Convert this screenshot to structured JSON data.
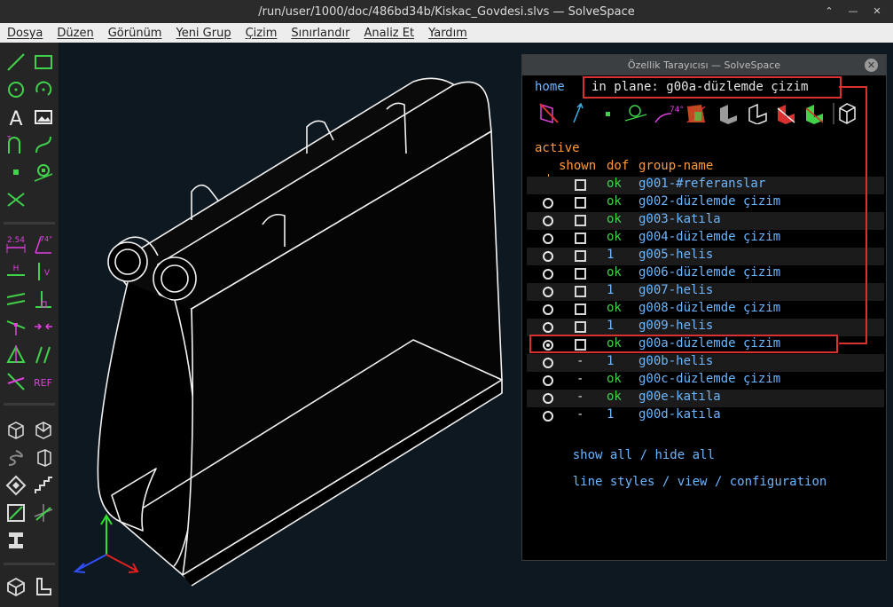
{
  "window": {
    "title": "/run/user/1000/doc/486bd34b/Kiskac_Govdesi.slvs — SolveSpace",
    "buttons": [
      "⌃",
      "—",
      "✕"
    ]
  },
  "menu": [
    "Dosya",
    "Düzen",
    "Görünüm",
    "Yeni Grup",
    "Çizim",
    "Sınırlandır",
    "Analiz Et",
    "Yardım"
  ],
  "toolbar": {
    "labels": {
      "dim": "2.54",
      "angle": "74°",
      "horiz": "H",
      "vert": "V",
      "ref": "REF",
      "text": "A"
    },
    "icons": [
      "line-icon",
      "rectangle-icon",
      "circle-icon",
      "arc-icon",
      "text-icon",
      "image-icon",
      "tangent-arc-icon",
      "bezier-icon",
      "point-icon",
      "construction-icon",
      "split-icon",
      "distance-constraint-icon",
      "angle-constraint-icon",
      "horizontal-icon",
      "vertical-icon",
      "parallel-icon",
      "perpendicular-icon",
      "point-on-line-icon",
      "midpoint-icon",
      "symmetric-icon",
      "equal-icon",
      "other-constraint-icon",
      "reference-icon",
      "workplane-icon",
      "extrude-icon",
      "lathe-icon",
      "revolve-icon",
      "helix-icon",
      "step-icon",
      "sketch-in-3d-icon",
      "sketch-in-plane-icon",
      "link-icon",
      "import-icon",
      "solid-icon",
      "step-translate-icon"
    ]
  },
  "browser": {
    "panel_title": "Özellik Tarayıcısı — SolveSpace",
    "close_label": "✕",
    "home_link": "home",
    "plane_text": "in plane: g00a-düzlemde çizim",
    "active_label": "active",
    "columns": {
      "shown": "shown",
      "dof": "dof",
      "group_name": "group-name"
    },
    "groups": [
      {
        "shown": "box",
        "dof": "ok",
        "name": "g001-#referanslar",
        "radio": "none"
      },
      {
        "shown": "box",
        "dof": "ok",
        "name": "g002-düzlemde çizim",
        "radio": "empty"
      },
      {
        "shown": "box",
        "dof": "ok",
        "name": "g003-katıla",
        "radio": "empty"
      },
      {
        "shown": "box",
        "dof": "ok",
        "name": "g004-düzlemde çizim",
        "radio": "empty"
      },
      {
        "shown": "box",
        "dof": "1",
        "name": "g005-helis",
        "radio": "empty"
      },
      {
        "shown": "box",
        "dof": "ok",
        "name": "g006-düzlemde çizim",
        "radio": "empty"
      },
      {
        "shown": "box",
        "dof": "1",
        "name": "g007-helis",
        "radio": "empty"
      },
      {
        "shown": "box",
        "dof": "ok",
        "name": "g008-düzlemde çizim",
        "radio": "empty"
      },
      {
        "shown": "box",
        "dof": "1",
        "name": "g009-helis",
        "radio": "empty"
      },
      {
        "shown": "box",
        "dof": "ok",
        "name": "g00a-düzlemde çizim",
        "radio": "selected"
      },
      {
        "shown": "dash",
        "dof": "1",
        "name": "g00b-helis",
        "radio": "empty"
      },
      {
        "shown": "dash",
        "dof": "ok",
        "name": "g00c-düzlemde çizim",
        "radio": "empty"
      },
      {
        "shown": "dash",
        "dof": "ok",
        "name": "g00e-katıla",
        "radio": "empty"
      },
      {
        "shown": "dash",
        "dof": "1",
        "name": "g00d-katıla",
        "radio": "empty"
      }
    ],
    "links_row1": {
      "show_all": "show all",
      "sep": " / ",
      "hide_all": "hide all"
    },
    "links_row2": {
      "line_styles": "line styles",
      "view": "view",
      "configuration": "configuration",
      "sep": " / "
    },
    "toolbar_angle_label": "74°"
  },
  "colors": {
    "accent_green": "#3fd24a",
    "link_blue": "#6cb6ff",
    "tool_magenta": "#e040e0",
    "active_orange": "#ff9a3c",
    "highlight_red": "#d93030",
    "viewport_bg": "#0e1820"
  }
}
